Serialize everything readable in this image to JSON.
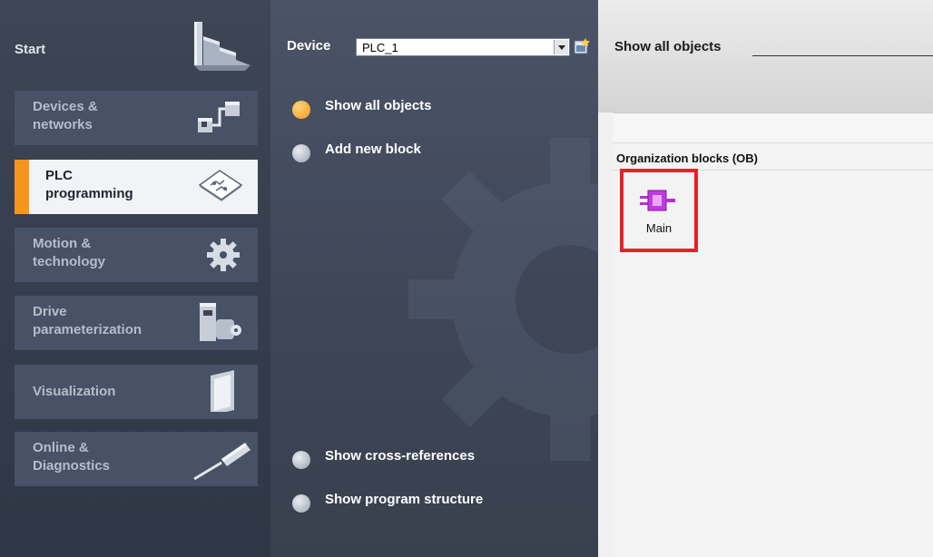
{
  "nav": {
    "start_label": "Start",
    "items": [
      {
        "label_line1": "Devices &",
        "label_line2": "networks",
        "icon": "devices-networks-icon"
      },
      {
        "label_line1": "PLC",
        "label_line2": "programming",
        "icon": "plc-programming-icon",
        "active": true
      },
      {
        "label_line1": "Motion &",
        "label_line2": "technology",
        "icon": "gear-icon"
      },
      {
        "label_line1": "Drive",
        "label_line2": "parameterization",
        "icon": "drive-motor-icon"
      },
      {
        "label_line1": "Visualization",
        "label_line2": "",
        "icon": "hmi-panel-icon"
      },
      {
        "label_line1": "Online &",
        "label_line2": "Diagnostics",
        "icon": "screwdriver-icon"
      }
    ]
  },
  "device": {
    "label": "Device",
    "selected": "PLC_1"
  },
  "actions": {
    "show_all_objects": "Show all objects",
    "add_new_block": "Add new block",
    "show_cross_references": "Show cross-references",
    "show_program_structure": "Show program structure"
  },
  "content": {
    "title": "Show all objects",
    "group_header": "Organization blocks (OB)",
    "blocks": [
      {
        "name": "Main",
        "icon": "ob-block-icon",
        "highlighted": true
      }
    ]
  },
  "colors": {
    "accent": "#f7941d",
    "highlight": "#e8202a",
    "ob_icon": "#b52fd6"
  }
}
